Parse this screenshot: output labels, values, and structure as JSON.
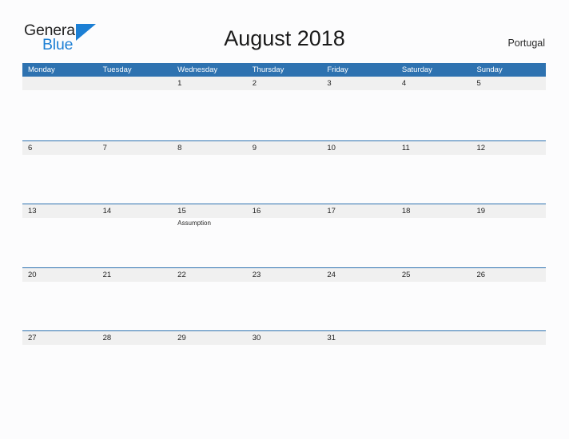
{
  "brand": {
    "word_one": "General",
    "word_two": "Blue",
    "flag_icon": "blue-triangle-flag-icon",
    "accent_color": "#1c7fd4"
  },
  "header": {
    "title": "August 2018",
    "region": "Portugal"
  },
  "calendar": {
    "header_bg": "#2e72b0",
    "band_bg": "#f0f0f0",
    "weekdays": [
      "Monday",
      "Tuesday",
      "Wednesday",
      "Thursday",
      "Friday",
      "Saturday",
      "Sunday"
    ],
    "weeks": [
      [
        {
          "day": "",
          "event": ""
        },
        {
          "day": "",
          "event": ""
        },
        {
          "day": "1",
          "event": ""
        },
        {
          "day": "2",
          "event": ""
        },
        {
          "day": "3",
          "event": ""
        },
        {
          "day": "4",
          "event": ""
        },
        {
          "day": "5",
          "event": ""
        }
      ],
      [
        {
          "day": "6",
          "event": ""
        },
        {
          "day": "7",
          "event": ""
        },
        {
          "day": "8",
          "event": ""
        },
        {
          "day": "9",
          "event": ""
        },
        {
          "day": "10",
          "event": ""
        },
        {
          "day": "11",
          "event": ""
        },
        {
          "day": "12",
          "event": ""
        }
      ],
      [
        {
          "day": "13",
          "event": ""
        },
        {
          "day": "14",
          "event": ""
        },
        {
          "day": "15",
          "event": "Assumption"
        },
        {
          "day": "16",
          "event": ""
        },
        {
          "day": "17",
          "event": ""
        },
        {
          "day": "18",
          "event": ""
        },
        {
          "day": "19",
          "event": ""
        }
      ],
      [
        {
          "day": "20",
          "event": ""
        },
        {
          "day": "21",
          "event": ""
        },
        {
          "day": "22",
          "event": ""
        },
        {
          "day": "23",
          "event": ""
        },
        {
          "day": "24",
          "event": ""
        },
        {
          "day": "25",
          "event": ""
        },
        {
          "day": "26",
          "event": ""
        }
      ],
      [
        {
          "day": "27",
          "event": ""
        },
        {
          "day": "28",
          "event": ""
        },
        {
          "day": "29",
          "event": ""
        },
        {
          "day": "30",
          "event": ""
        },
        {
          "day": "31",
          "event": ""
        },
        {
          "day": "",
          "event": ""
        },
        {
          "day": "",
          "event": ""
        }
      ]
    ]
  }
}
